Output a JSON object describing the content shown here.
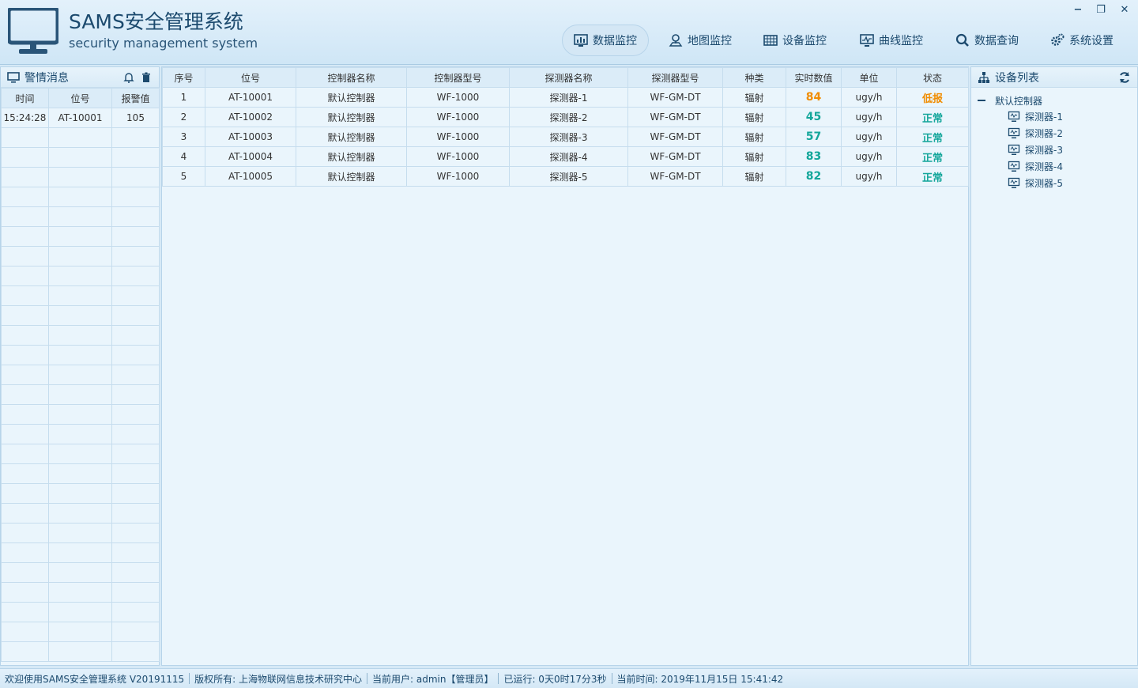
{
  "header": {
    "title": "SAMS安全管理系统",
    "subtitle": "security management system",
    "nav": [
      {
        "label": "数据监控",
        "icon": "bar-chart-icon",
        "active": true
      },
      {
        "label": "地图监控",
        "icon": "map-pin-icon",
        "active": false
      },
      {
        "label": "设备监控",
        "icon": "grid-icon",
        "active": false
      },
      {
        "label": "曲线监控",
        "icon": "line-monitor-icon",
        "active": false
      },
      {
        "label": "数据查询",
        "icon": "search-icon",
        "active": false
      },
      {
        "label": "系统设置",
        "icon": "gears-icon",
        "active": false
      }
    ],
    "window_controls": {
      "minimize": "−",
      "restore": "❐",
      "close": "✕"
    }
  },
  "alarm_panel": {
    "title": "警情消息",
    "columns": [
      "时间",
      "位号",
      "报警值"
    ],
    "rows": [
      [
        "15:24:28",
        "AT-10001",
        "105"
      ]
    ]
  },
  "data_table": {
    "columns": [
      "序号",
      "位号",
      "控制器名称",
      "控制器型号",
      "探测器名称",
      "探测器型号",
      "种类",
      "实时数值",
      "单位",
      "状态"
    ],
    "rows": [
      {
        "idx": "1",
        "tag": "AT-10001",
        "controller": "默认控制器",
        "controller_model": "WF-1000",
        "detector": "探测器-1",
        "detector_model": "WF-GM-DT",
        "kind": "辐射",
        "value": "84",
        "unit": "ugy/h",
        "status": "低报",
        "status_color": "#f08c00"
      },
      {
        "idx": "2",
        "tag": "AT-10002",
        "controller": "默认控制器",
        "controller_model": "WF-1000",
        "detector": "探测器-2",
        "detector_model": "WF-GM-DT",
        "kind": "辐射",
        "value": "45",
        "unit": "ugy/h",
        "status": "正常",
        "status_color": "#13a69a"
      },
      {
        "idx": "3",
        "tag": "AT-10003",
        "controller": "默认控制器",
        "controller_model": "WF-1000",
        "detector": "探测器-3",
        "detector_model": "WF-GM-DT",
        "kind": "辐射",
        "value": "57",
        "unit": "ugy/h",
        "status": "正常",
        "status_color": "#13a69a"
      },
      {
        "idx": "4",
        "tag": "AT-10004",
        "controller": "默认控制器",
        "controller_model": "WF-1000",
        "detector": "探测器-4",
        "detector_model": "WF-GM-DT",
        "kind": "辐射",
        "value": "83",
        "unit": "ugy/h",
        "status": "正常",
        "status_color": "#13a69a"
      },
      {
        "idx": "5",
        "tag": "AT-10005",
        "controller": "默认控制器",
        "controller_model": "WF-1000",
        "detector": "探测器-5",
        "detector_model": "WF-GM-DT",
        "kind": "辐射",
        "value": "82",
        "unit": "ugy/h",
        "status": "正常",
        "status_color": "#13a69a"
      }
    ]
  },
  "device_panel": {
    "title": "设备列表",
    "root": "默认控制器",
    "children": [
      "探测器-1",
      "探测器-2",
      "探测器-3",
      "探测器-4",
      "探测器-5"
    ]
  },
  "statusbar": {
    "welcome": "欢迎使用SAMS安全管理系统 V20191115",
    "copyright": "版权所有: 上海物联网信息技术研究中心",
    "user": "当前用户: admin【管理员】",
    "uptime": "已运行: 0天0时17分3秒",
    "time": "当前时间: 2019年11月15日 15:41:42"
  },
  "colors": {
    "accent": "#1c4a6e",
    "warning": "#f08c00",
    "normal": "#13a69a"
  }
}
